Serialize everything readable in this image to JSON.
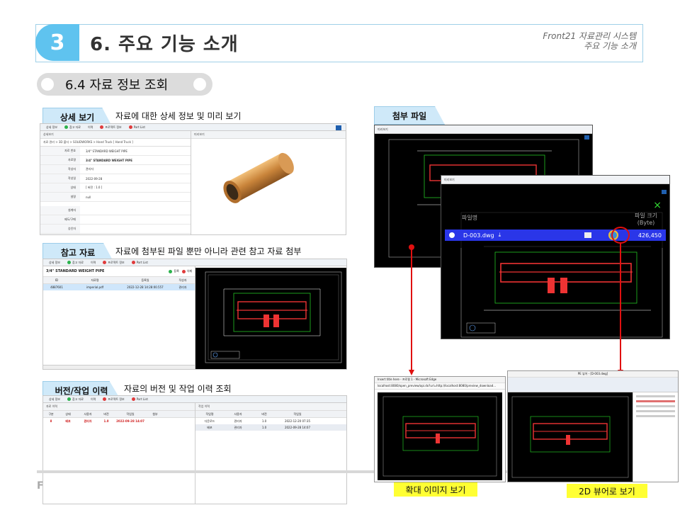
{
  "header": {
    "section_number": "3",
    "title": "6. 주요 기능 소개",
    "system_name": "Front21 자료관리 시스템",
    "system_sub": "주요 기능 소개"
  },
  "subsection": {
    "title": "6.4 자료 정보 조회"
  },
  "detail": {
    "tab_label": "상세 보기",
    "description": "자료에 대한 상세 정보 및 미리 보기",
    "toolbar": [
      "상세 정보",
      "참고 자료",
      "이력",
      "프로젝트 정보",
      "Part List"
    ],
    "left_title": "상세보기",
    "right_title": "미리보기",
    "breadcrumb": "자료 관리 > 3D 폴더 > SOLIDWORKS > Hand Truck [ Hand Truck ]",
    "fields": [
      {
        "key": "자료 번호",
        "value": "3/4\" STANDARD WEIGHT PIPE"
      },
      {
        "key": "자료명",
        "value": "3/4\" STANDARD WEIGHT PIPE"
      },
      {
        "key": "작성자",
        "value": "관리자"
      },
      {
        "key": "작성일",
        "value": "2022-09-28"
      },
      {
        "key": "상태",
        "value": "[ 버전 : 1.0 ]"
      },
      {
        "key": "설명",
        "value": "null"
      },
      {
        "key": "설계자",
        "value": ""
      },
      {
        "key": "제도/구매",
        "value": ""
      },
      {
        "key": "승인자",
        "value": ""
      },
      {
        "key": "공급업체",
        "value": ""
      }
    ]
  },
  "reference": {
    "tab_label": "참고 자료",
    "description": "자료에 첨부된 파일 뿐만 아니라 관련 참고 자료 첨부",
    "toolbar": [
      "상세 정보",
      "참고 자료",
      "이력",
      "프로젝트 정보",
      "Part List"
    ],
    "heading": "3/4\" STANDARD WEIGHT PIPE",
    "register_label": "등록",
    "delete_label": "삭제",
    "columns": [
      "ID",
      "자료명",
      "등록일",
      "작성자"
    ],
    "rows": [
      {
        "id": "4887601",
        "name": "imperial.pdf",
        "date": "2022-12-28 14:28:00.557",
        "author": "관리자"
      }
    ]
  },
  "history": {
    "tab_label": "버전/작업 이력",
    "description": "자료의 버전 및 작업 이력 조회",
    "toolbar": [
      "상세 정보",
      "참고 자료",
      "이력",
      "프로젝트 정보",
      "Part List"
    ],
    "left_title": "자료 이력",
    "right_title": "작업 이력",
    "left_columns": [
      "구분",
      "상태",
      "사용자",
      "버전",
      "작업일",
      "첨부"
    ],
    "left_rows": [
      {
        "type": "8",
        "status": "배포",
        "user": "관리자",
        "version": "1.0",
        "date": "2022-09-28 14:07"
      }
    ],
    "right_columns": [
      "작업명",
      "사용자",
      "버전",
      "작업일"
    ],
    "right_rows": [
      {
        "name": "다운로드",
        "user": "관리자",
        "version": "1.0",
        "date": "2022-12-20 07:35"
      },
      {
        "name": "배포",
        "user": "관리자",
        "version": "1.0",
        "date": "2022-09-28 14:07"
      }
    ]
  },
  "attachment": {
    "tab_label": "첨부 파일",
    "preview_title": "미리보기",
    "file_header_name": "파일명",
    "file_header_size": "파일 크기",
    "file_header_unit": "(Byte)",
    "file_name": "D-003.dwg",
    "file_size": "426,450",
    "close_icon": "×"
  },
  "bottom": {
    "browser_title": "Insert title here - 프로필 1 - Microsoft Edge",
    "browser_url": "localhost:8080/open_preview/api.do?url=http://localhost:8080/preview_download...",
    "viewer_title": "PE 뷰어 - [D-003.dwg]",
    "enlarge_label": "확대 이미지 보기",
    "viewer_label": "2D 뷰어로 보기"
  },
  "footer": {
    "letter": "F"
  },
  "colors": {
    "accent": "#5fc3ef",
    "tab_bg": "#cfe9f9",
    "highlight_row": "#2a36e8",
    "annotation_red": "#e01010",
    "label_yellow": "#ffff33"
  }
}
